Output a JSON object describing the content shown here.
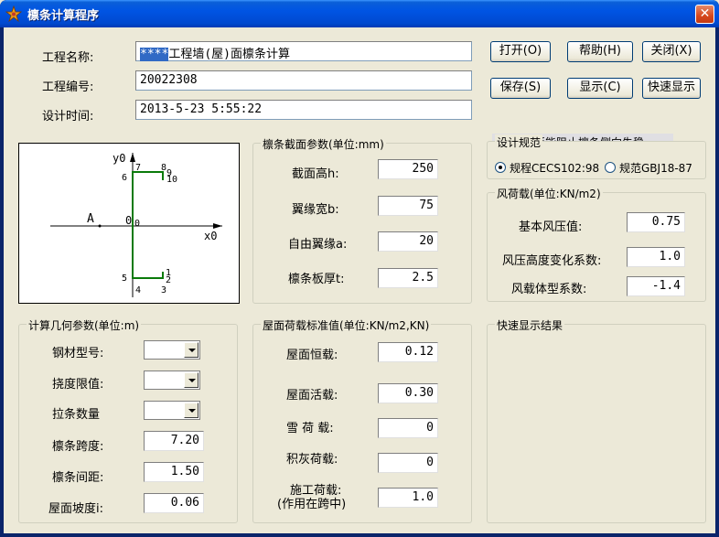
{
  "window": {
    "title": "檩条计算程序",
    "close_glyph": "✕"
  },
  "project": {
    "name_label": "工程名称:",
    "name_selected": "****",
    "name_rest": "工程墙(屋)面檩条计算",
    "number_label": "工程编号:",
    "number_value": "20022308",
    "time_label": "设计时间:",
    "time_value": "2013-5-23 5:55:22"
  },
  "buttons": {
    "open": "打开(O)",
    "help": "帮助(H)",
    "close": "关闭(X)",
    "save": "保存(S)",
    "show": "显示(C)",
    "quick_show": "快速显示"
  },
  "checkbox": {
    "label": "屋面板能阻止檩条侧向失稳",
    "checked": false
  },
  "diagram": {
    "y_axis": "y0",
    "x_axis": "x0",
    "point_a": "A",
    "origin": "0",
    "points": [
      "1",
      "2",
      "3",
      "4",
      "5",
      "6",
      "7",
      "8",
      "9",
      "10"
    ]
  },
  "section": {
    "title": "檩条截面参数(单位:mm)",
    "height_label": "截面高h:",
    "height_value": "250",
    "flange_label": "翼缘宽b:",
    "flange_value": "75",
    "lip_label": "自由翼缘a:",
    "lip_value": "20",
    "thick_label": "檩条板厚t:",
    "thick_value": "2.5"
  },
  "code": {
    "title": "设计规范",
    "opt1": "规程CECS102:98",
    "opt2": "规范GBJ18-87",
    "selected": "opt1"
  },
  "wind": {
    "title": "风荷载(单位:KN/m2)",
    "base_label": "基本风压值:",
    "base_value": "0.75",
    "height_label": "风压高度变化系数:",
    "height_value": "1.0",
    "shape_label": "风载体型系数:",
    "shape_value": "-1.4"
  },
  "geometry": {
    "title": "计算几何参数(单位:m)",
    "steel_label": "钢材型号:",
    "steel_value": "",
    "deflect_label": "挠度限值:",
    "deflect_value": "",
    "tie_label": "拉条数量",
    "tie_value": "",
    "span_label": "檩条跨度:",
    "span_value": "7.20",
    "spacing_label": "檩条间距:",
    "spacing_value": "1.50",
    "slope_label": "屋面坡度i:",
    "slope_value": "0.06"
  },
  "loads": {
    "title": "屋面荷载标准值(单位:KN/m2,KN)",
    "dead_label": "屋面恒载:",
    "dead_value": "0.12",
    "live_label": "屋面活载:",
    "live_value": "0.30",
    "snow_label": "雪 荷 载:",
    "snow_value": "0",
    "ash_label": "积灰荷载:",
    "ash_value": "0",
    "const_label1": "施工荷载:",
    "const_label2": "(作用在跨中)",
    "const_value": "1.0"
  },
  "quick": {
    "title": "快速显示结果"
  }
}
